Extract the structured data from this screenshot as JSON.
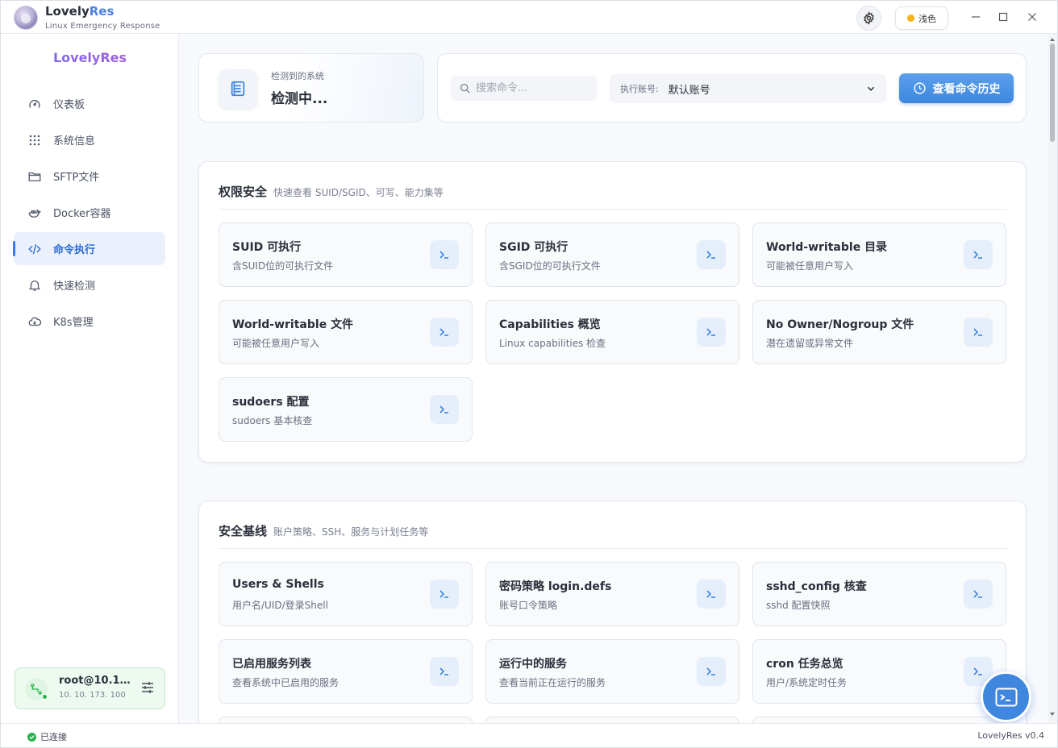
{
  "app": {
    "name_part1": "Lovely",
    "name_part2": "Res",
    "subtitle": "Linux Emergency Response",
    "theme_label": "浅色"
  },
  "sidebar": {
    "brand": "LovelyRes",
    "items": [
      {
        "label": "仪表板",
        "icon": "gauge-icon",
        "active": false
      },
      {
        "label": "系统信息",
        "icon": "grid-dots-icon",
        "active": false
      },
      {
        "label": "SFTP文件",
        "icon": "folder-icon",
        "active": false
      },
      {
        "label": "Docker容器",
        "icon": "docker-icon",
        "active": false
      },
      {
        "label": "命令执行",
        "icon": "code-icon",
        "active": true
      },
      {
        "label": "快速检测",
        "icon": "bell-icon",
        "active": false
      },
      {
        "label": "K8s管理",
        "icon": "cloud-icon",
        "active": false
      }
    ],
    "connection": {
      "user": "root@10.10.…",
      "ip": "10. 10. 173. 100"
    }
  },
  "status": {
    "connected": "已连接",
    "version": "LovelyRes v0.4"
  },
  "system_card": {
    "label": "检测到的系统",
    "value": "检测中..."
  },
  "toolbar": {
    "search_placeholder": "搜索命令...",
    "account_label": "执行账号:",
    "account_value": "默认账号",
    "history_button": "查看命令历史"
  },
  "sections": [
    {
      "title": "权限安全",
      "subtitle": "快速查看 SUID/SGID、可写、能力集等",
      "commands": [
        {
          "title": "SUID 可执行",
          "desc": "含SUID位的可执行文件"
        },
        {
          "title": "SGID 可执行",
          "desc": "含SGID位的可执行文件"
        },
        {
          "title": "World-writable 目录",
          "desc": "可能被任意用户写入"
        },
        {
          "title": "World-writable 文件",
          "desc": "可能被任意用户写入"
        },
        {
          "title": "Capabilities 概览",
          "desc": "Linux capabilities 检查"
        },
        {
          "title": "No Owner/Nogroup 文件",
          "desc": "潜在遗留或异常文件"
        },
        {
          "title": "sudoers 配置",
          "desc": "sudoers 基本核查"
        }
      ]
    },
    {
      "title": "安全基线",
      "subtitle": "账户策略、SSH、服务与计划任务等",
      "commands": [
        {
          "title": "Users & Shells",
          "desc": "用户名/UID/登录Shell"
        },
        {
          "title": "密码策略 login.defs",
          "desc": "账号口令策略"
        },
        {
          "title": "sshd_config 核查",
          "desc": "sshd 配置快照"
        },
        {
          "title": "已启用服务列表",
          "desc": "查看系统中已启用的服务"
        },
        {
          "title": "运行中的服务",
          "desc": "查看当前正在运行的服务"
        },
        {
          "title": "cron 任务总览",
          "desc": "用户/系统定时任务"
        }
      ]
    }
  ],
  "colors": {
    "accent": "#3e86de",
    "active_nav_bg": "#eaf1fd",
    "connected_green": "#27b24a"
  }
}
